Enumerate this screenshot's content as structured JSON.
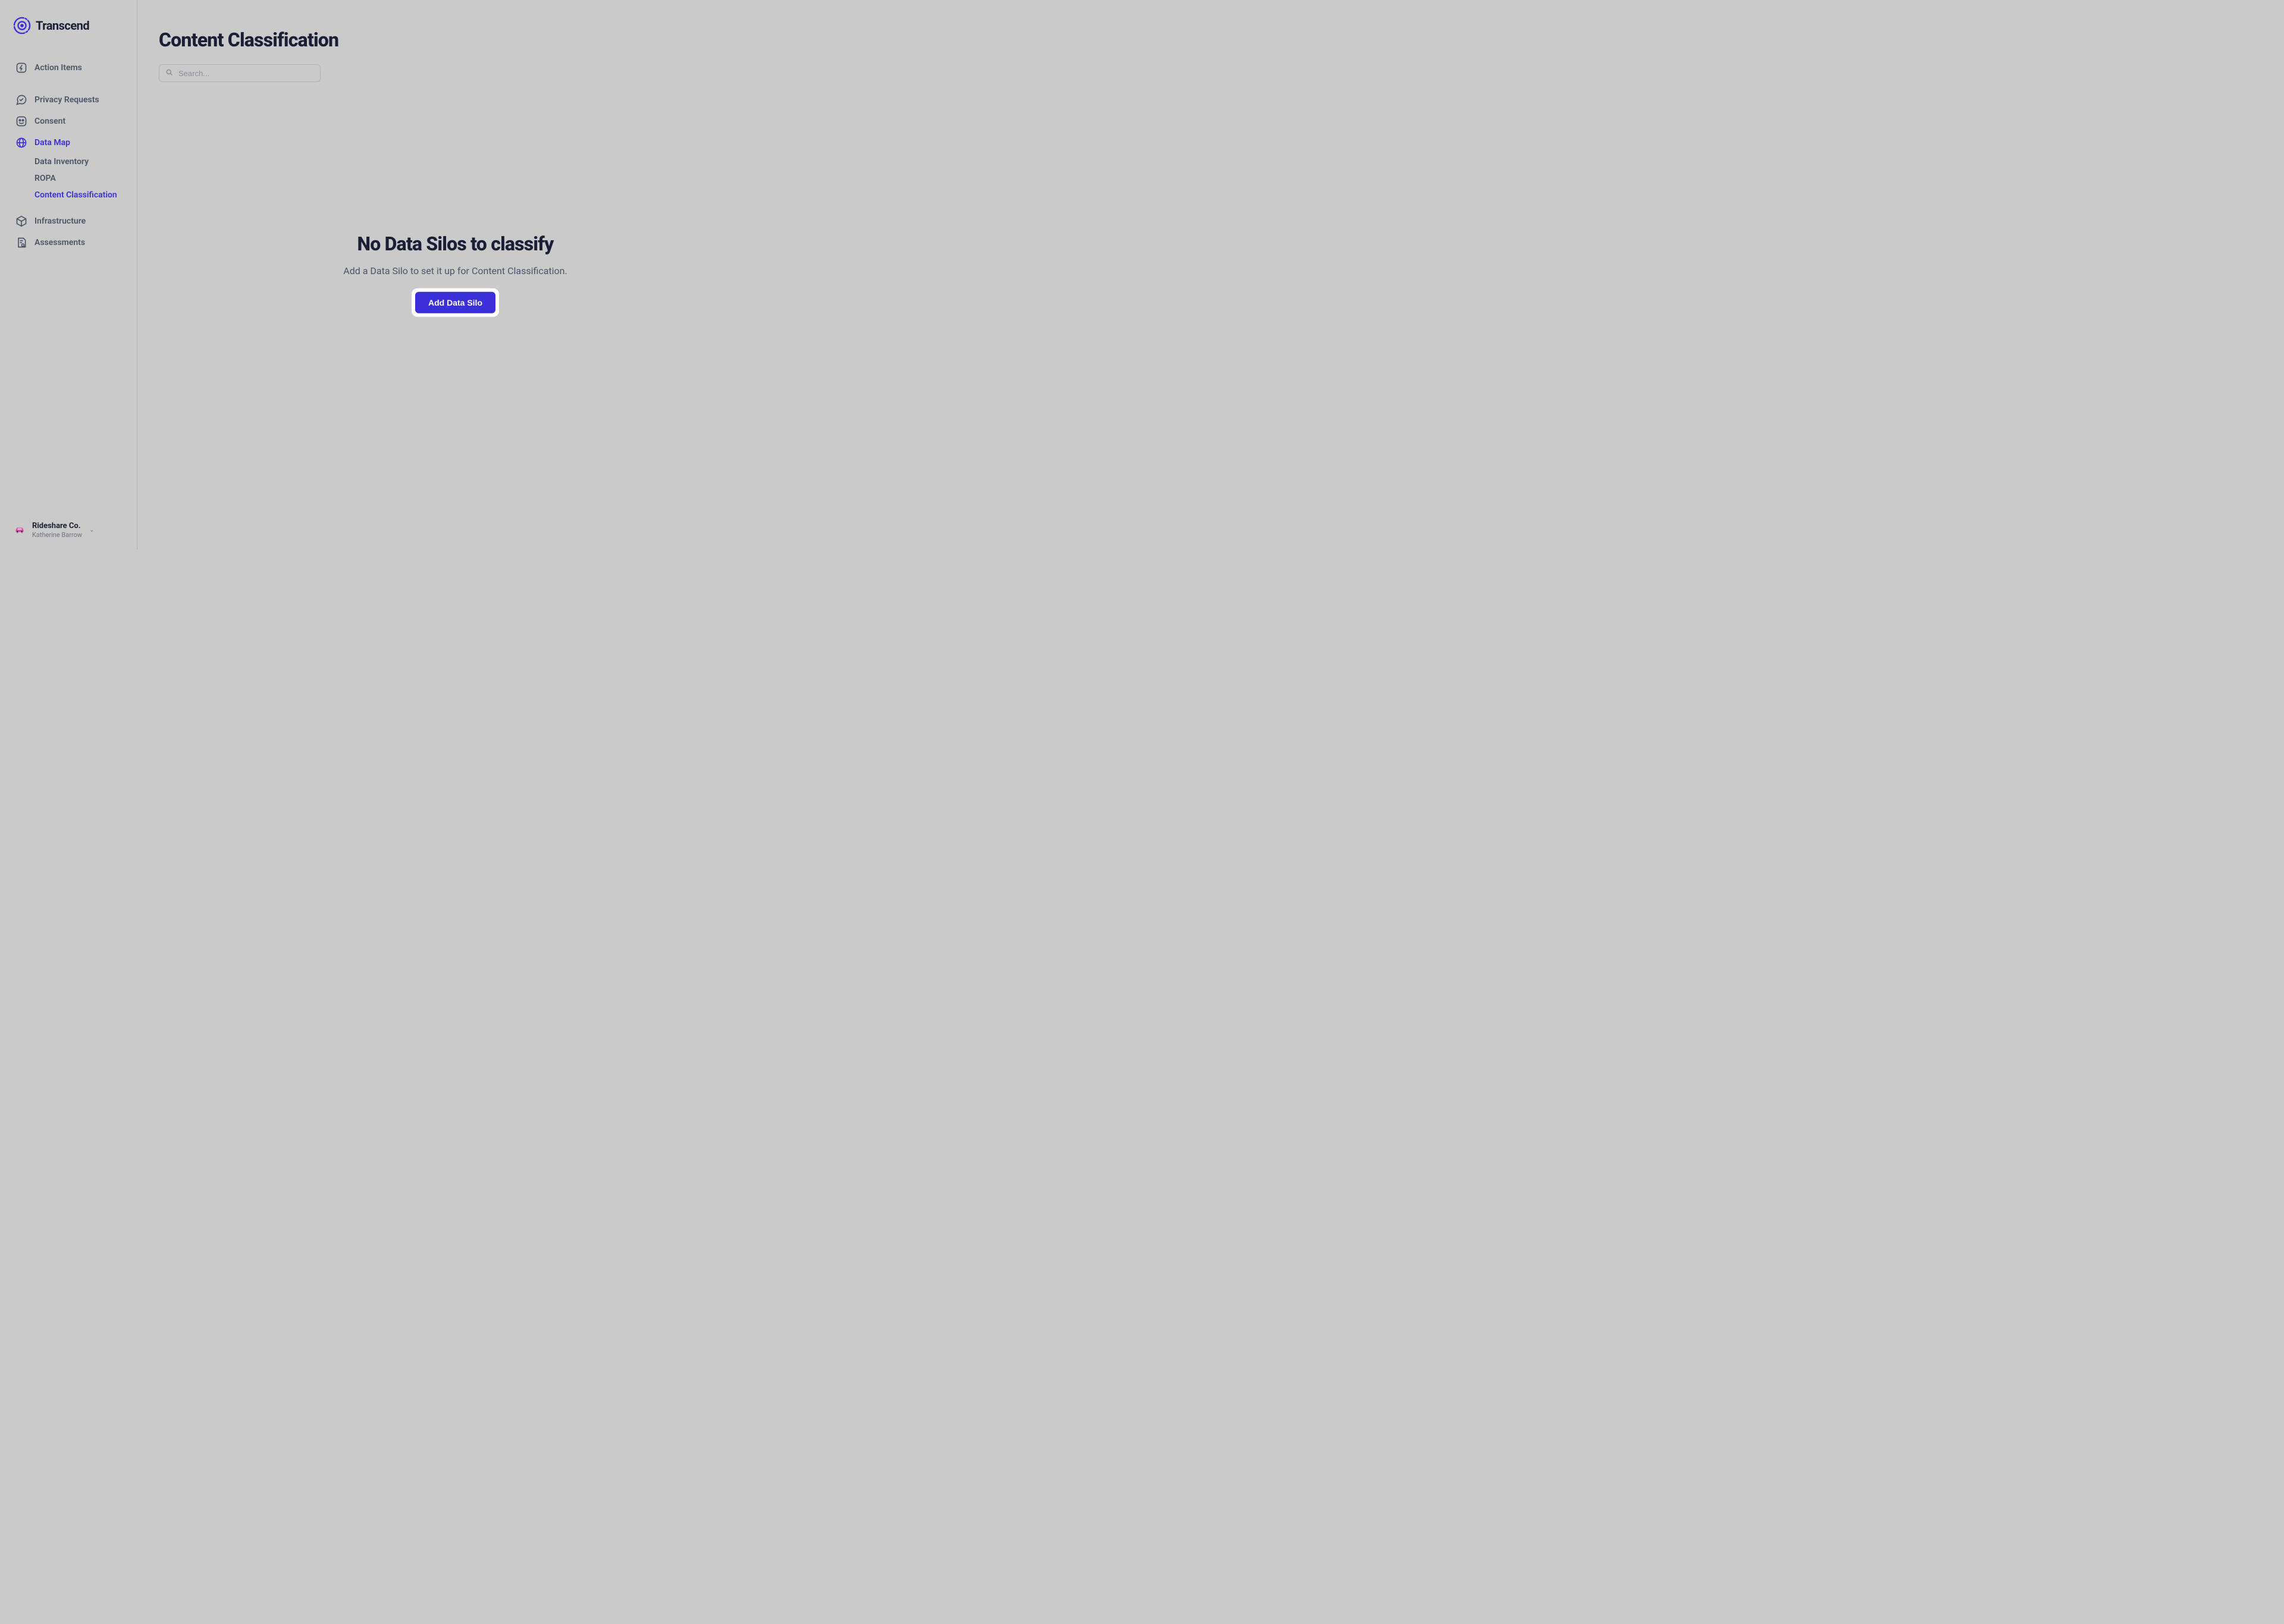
{
  "brand": {
    "name": "Transcend"
  },
  "sidebar": {
    "action_items": "Action Items",
    "privacy_requests": "Privacy Requests",
    "consent": "Consent",
    "data_map": "Data Map",
    "data_map_sub": {
      "data_inventory": "Data Inventory",
      "ropa": "ROPA",
      "content_classification": "Content Classification"
    },
    "infrastructure": "Infrastructure",
    "assessments": "Assessments"
  },
  "footer": {
    "org_name": "Rideshare Co.",
    "user_name": "Katherine Barrow"
  },
  "page": {
    "title": "Content Classification",
    "search_placeholder": "Search..."
  },
  "empty_state": {
    "title": "No Data Silos to classify",
    "description": "Add a Data Silo to set it up for Content Classification.",
    "cta": "Add Data Silo"
  },
  "colors": {
    "accent": "#3b2fd9",
    "text_primary": "#1a1f36",
    "text_secondary": "#4a5568"
  }
}
